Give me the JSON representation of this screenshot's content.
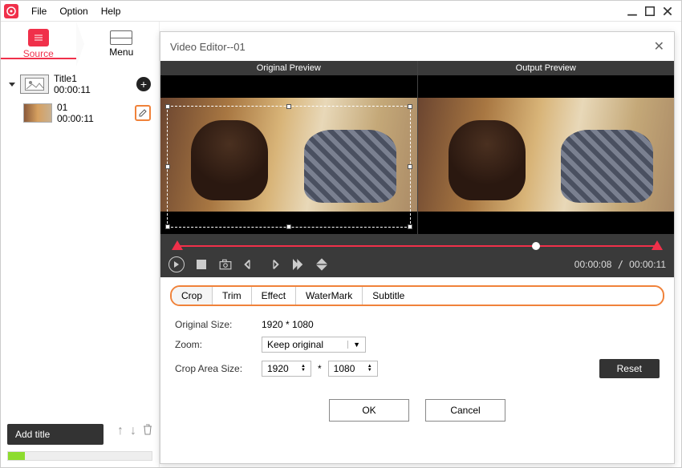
{
  "menubar": {
    "file": "File",
    "option": "Option",
    "help": "Help"
  },
  "tabs": {
    "source": "Source",
    "menu": "Menu"
  },
  "tree": {
    "title": {
      "name": "Title1",
      "duration": "00:00:11"
    },
    "clip": {
      "name": "01",
      "duration": "00:00:11"
    }
  },
  "sidebar": {
    "add_title": "Add title"
  },
  "dialog": {
    "title": "Video Editor--01",
    "preview_original": "Original Preview",
    "preview_output": "Output Preview",
    "time_current": "00:00:08",
    "time_total": "00:00:11",
    "tabs": {
      "crop": "Crop",
      "trim": "Trim",
      "effect": "Effect",
      "watermark": "WaterMark",
      "subtitle": "Subtitle"
    },
    "form": {
      "original_size_label": "Original Size:",
      "original_size_value": "1920 * 1080",
      "zoom_label": "Zoom:",
      "zoom_value": "Keep original",
      "crop_area_label": "Crop Area Size:",
      "crop_w": "1920",
      "crop_sep": "*",
      "crop_h": "1080"
    },
    "buttons": {
      "reset": "Reset",
      "ok": "OK",
      "cancel": "Cancel"
    }
  }
}
